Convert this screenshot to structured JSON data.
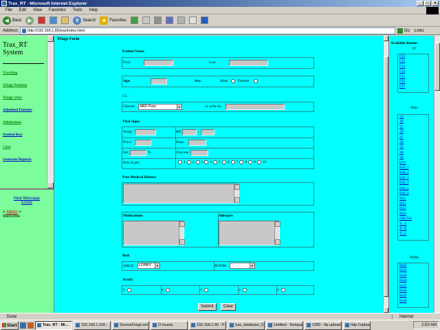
{
  "window": {
    "title": "Trax_RT - Microsoft Internet Explorer",
    "buttons": [
      "_",
      "□",
      "×"
    ]
  },
  "menu": [
    "File",
    "Edit",
    "View",
    "Favorites",
    "Tools",
    "Help"
  ],
  "toolbar": {
    "back": "Back",
    "search": "Search",
    "favorites": "Favorites"
  },
  "address": {
    "label": "Address",
    "url": "http://192.168.1.85/trax/index.html",
    "go": "Go",
    "links": "Links"
  },
  "left_nav": {
    "app_title": "Trax_RT System",
    "links": [
      "Tracking",
      "Triage Patients",
      "Triage View",
      "Admitted Patients",
      "Admissions",
      "Symbol Key",
      "Chat",
      "Generate Reports"
    ],
    "new_message": "New Message",
    "erase": "Erase",
    "admin_prefix": "< ",
    "admin_link": "Admin",
    "admin_suffix": " >",
    "welcome": "Welcome"
  },
  "form": {
    "title": "Triage Form",
    "patient_name": "Patient Name",
    "first": "First:",
    "last": "Last:",
    "age": "Age:",
    "sex": "Sex:",
    "male": "Male",
    "female": "Female",
    "cc": "CC:",
    "choose": "Choose:",
    "cc_selected": "ABD Pain",
    "write_in": "or write in:",
    "vital_signs": "Vital Signs",
    "temp": "Temp:",
    "bp": "BP:",
    "bp_sep": "/",
    "pulse": "Pulse:",
    "resp": "Resp:",
    "sat": "Sat:",
    "sat_unit": "%",
    "glucose": "Glucose:",
    "pain_scale": "Pain Scale:",
    "pain_values": [
      "1",
      "2",
      "3",
      "4",
      "5",
      "6",
      "7",
      "8",
      "9",
      "10"
    ],
    "past_medical_history": "Past Medical History",
    "medications": "Medications",
    "allergies": "Allergies",
    "bed": "Bed:",
    "area": "AREA:",
    "area_selected": "LOBBY",
    "room": "ROOM:",
    "room_selected": "",
    "acuity": "Acuity",
    "acuity_values": [
      "5",
      "4",
      "3",
      "2",
      "1"
    ],
    "submit": "Submit",
    "clear": "Clear"
  },
  "rooms": {
    "title": "Available Rooms",
    "ft_label": "FT",
    "ft": [
      "FT1",
      "FT2",
      "FT3",
      "FT4",
      "FT5",
      "FT6",
      "FT7"
    ],
    "main_label": "Main",
    "main": [
      "1A",
      "1B",
      "1C",
      "1D",
      "2C",
      "2D",
      "3A",
      "3B",
      "3D",
      "ENT",
      "Hall_1",
      "Hall_2",
      "Hall_3",
      "Hall_4",
      "Hall_5",
      "Hall_6",
      "MS1",
      "MS2",
      "MS3",
      "MS4",
      "OBGYN",
      "Tr_A",
      "Tr_B",
      "Tr_C"
    ],
    "pods_label": "PODS",
    "pods": [
      "Bed1",
      "Bed2",
      "Bed3",
      "Bed4",
      "Bed5",
      "Bed6",
      "Bed7",
      "Bed8"
    ]
  },
  "status": {
    "text": "Done",
    "zone": "Internet"
  },
  "taskbar": {
    "start": "Start",
    "tasks": [
      "Trax_RT - Mi...",
      "192.168.1.100 - ...",
      "SourceForge.net:...",
      "D:\\scans",
      "192.168.1.50 - P...",
      "trax_database_0...",
      "Untitled - Notepad",
      "CMD - ftp upload...",
      "http://upload.sou..."
    ],
    "clock": "2:53 AM"
  }
}
